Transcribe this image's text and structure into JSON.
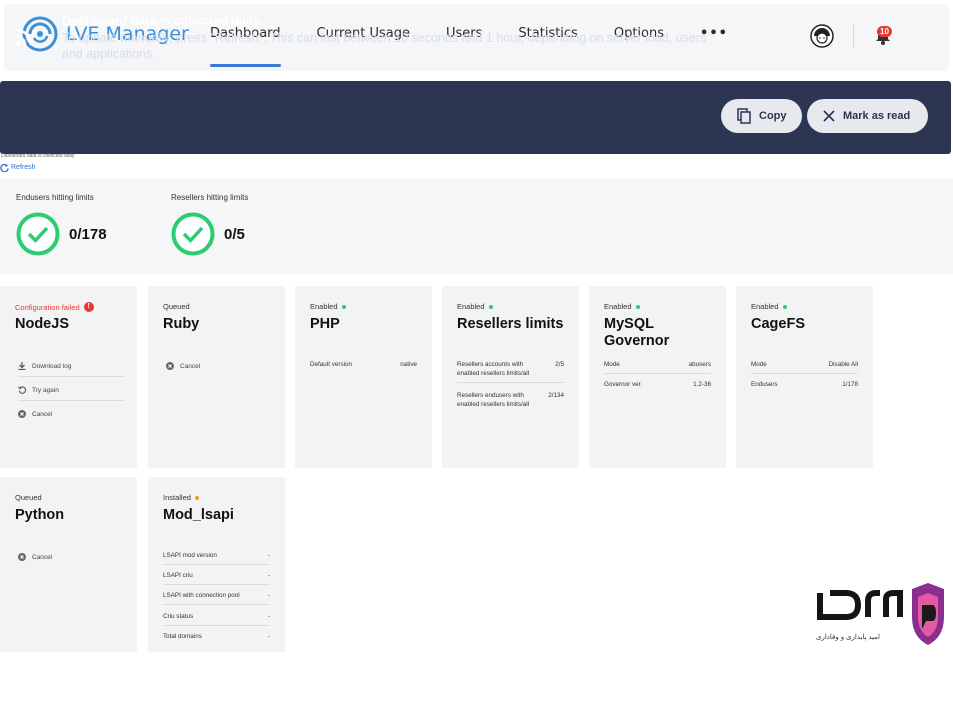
{
  "app": {
    "title": "LVE Manager"
  },
  "nav": {
    "items": [
      "Dashboard",
      "Current Usage",
      "Users",
      "Statistics",
      "Options"
    ],
    "more": "•••",
    "active": "Dashboard"
  },
  "notifications": {
    "count": "10"
  },
  "banner": {
    "title": "Dashboard data is collected daily.",
    "text": "To update manually, press \"Refresh\". This can last between 10 seconds and 1 hour, depending on server load, users and applications.",
    "copy_label": "Copy",
    "mark_label": "Mark as read"
  },
  "refresh": {
    "label": "Refresh",
    "tiny": "Dashboard data is collected daily"
  },
  "summary": {
    "endusers": {
      "label": "Endusers hitting limits",
      "value": "0/178"
    },
    "resellers": {
      "label": "Resellers hitting limits",
      "value": "0/5"
    }
  },
  "cards": {
    "nodejs": {
      "status": "Configuration failed",
      "title": "NodeJS",
      "actions": [
        "Download log",
        "Try again",
        "Cancel"
      ]
    },
    "ruby": {
      "status": "Queued",
      "title": "Ruby",
      "actions": [
        "Cancel"
      ]
    },
    "php": {
      "status": "Enabled",
      "title": "PHP",
      "rows": [
        {
          "k": "Default version",
          "v": "native"
        }
      ]
    },
    "resellers": {
      "status": "Enabled",
      "title": "Resellers limits",
      "rows": [
        {
          "k": "Resellers accounts with enabled resellers limits/all",
          "v": "2/5"
        },
        {
          "k": "Resellers endusers with enabled resellers limits/all",
          "v": "2/134"
        }
      ]
    },
    "mysql": {
      "status": "Enabled",
      "title": "MySQL Governor",
      "rows": [
        {
          "k": "Mode",
          "v": "abusers"
        },
        {
          "k": "Governor ver.",
          "v": "1.2-36"
        }
      ]
    },
    "cagefs": {
      "status": "Enabled",
      "title": "CageFS",
      "rows": [
        {
          "k": "Mode",
          "v": "Disable All"
        },
        {
          "k": "Endusers",
          "v": "1/178"
        }
      ]
    },
    "python": {
      "status": "Queued",
      "title": "Python",
      "actions": [
        "Cancel"
      ]
    },
    "modlsapi": {
      "status": "Installed",
      "title": "Mod_lsapi",
      "rows": [
        {
          "k": "LSAPI mod version",
          "v": "-"
        },
        {
          "k": "LSAPI criu",
          "v": "-"
        },
        {
          "k": "LSAPI with connection pool",
          "v": "-"
        },
        {
          "k": "Criu status",
          "v": "-"
        },
        {
          "k": "Total domains",
          "v": "-"
        }
      ]
    }
  },
  "watermark": {
    "text": "امید پایداری و وفاداری"
  },
  "colors": {
    "accent": "#3a7bd5",
    "banner_bg": "#2c3551",
    "ok_green": "#2ecc71",
    "error_red": "#e53935"
  }
}
